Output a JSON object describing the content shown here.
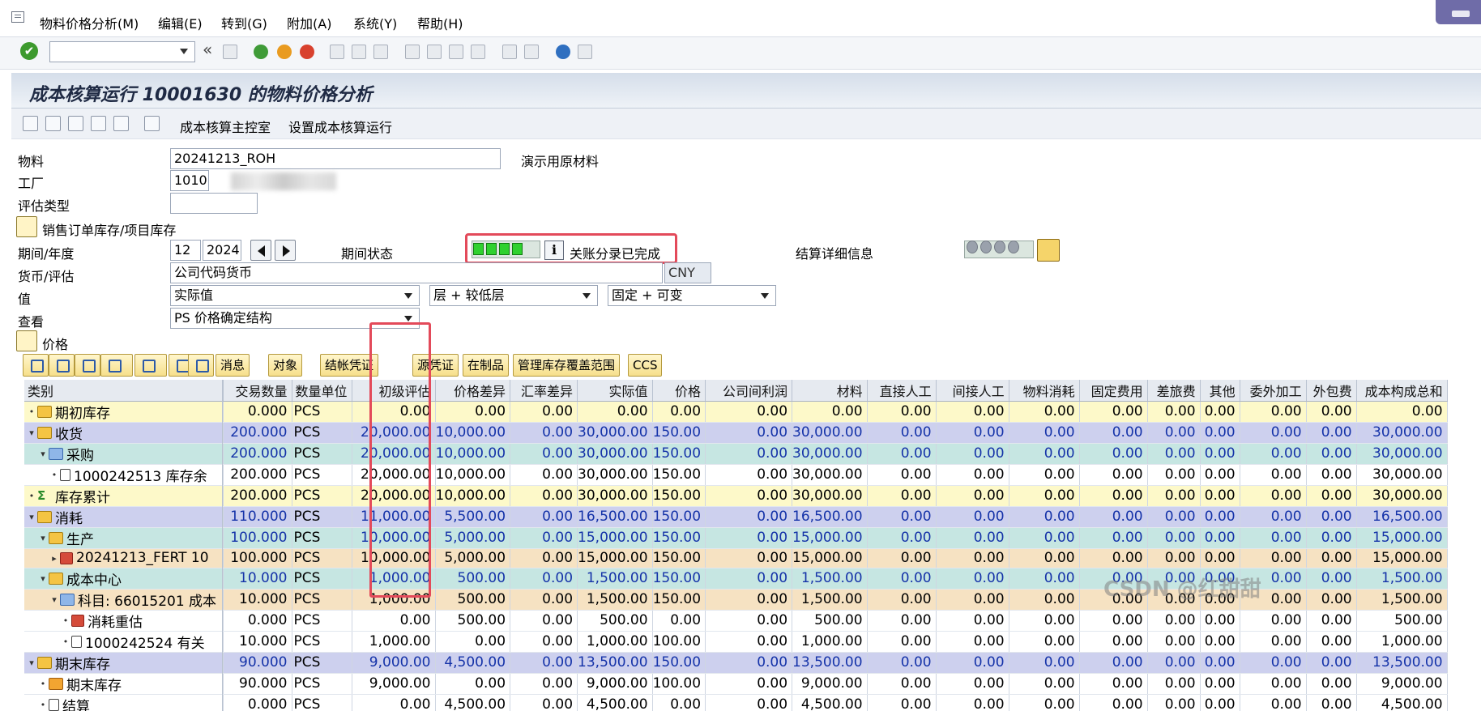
{
  "menubar": {
    "items": [
      "物料价格分析(M)",
      "编辑(E)",
      "转到(G)",
      "附加(A)",
      "系统(Y)",
      "帮助(H)"
    ]
  },
  "toolbar": {
    "command_value": ""
  },
  "header": {
    "title": "成本核算运行 10001630 的物料价格分析"
  },
  "app_toolbar": {
    "btn_cockpit": "成本核算主控室",
    "btn_setup": "设置成本核算运行"
  },
  "form": {
    "material_label": "物料",
    "material_value": "20241213_ROH",
    "material_desc": "演示用原材料",
    "plant_label": "工厂",
    "plant_value": "1010",
    "valtype_label": "评估类型",
    "valtype_value": "",
    "sales_order_label": "销售订单库存/项目库存",
    "period_label": "期间/年度",
    "period_value": "12",
    "year_value": "2024",
    "period_status_label": "期间状态",
    "period_status_text": "关账分录已完成",
    "settlement_label": "结算详细信息",
    "currency_label": "货币/评估",
    "currency_value": "公司代码货币",
    "currency_code": "CNY",
    "value_label": "值",
    "value_select": "实际值",
    "level_select": "层 + 较低层",
    "fixvar_select": "固定 + 可变",
    "view_label": "查看",
    "view_select": "PS 价格确定结构",
    "price_section": "价格"
  },
  "grid_toolbar": {
    "messages": "消息",
    "objects": "对象",
    "settle_doc": "结帐凭证",
    "source_doc": "源凭证",
    "wip": "在制品",
    "stock_range": "管理库存覆盖范围",
    "ccs": "CCS"
  },
  "table": {
    "headers": [
      "类别",
      "交易数量",
      "数量单位",
      "初级评估",
      "价格差异",
      "汇率差异",
      "实际值",
      "价格",
      "公司间利润",
      "材料",
      "直接人工",
      "间接人工",
      "物料消耗",
      "固定费用",
      "差旅费",
      "其他",
      "委外加工",
      "外包费",
      "成本构成总和"
    ],
    "rows": [
      {
        "tree": "•",
        "icon": "folder",
        "label": "期初库存",
        "indent": 0,
        "style": "yellow",
        "blue": false,
        "v": [
          "0.000",
          "PCS",
          "0.00",
          "0.00",
          "0.00",
          "0.00",
          "0.00",
          "0.00",
          "0.00",
          "0.00",
          "0.00",
          "0.00",
          "0.00",
          "0.00",
          "0.00",
          "0.00",
          "0.00",
          "0.00"
        ]
      },
      {
        "tree": "▾",
        "icon": "folder",
        "label": "收货",
        "indent": 0,
        "style": "lav",
        "blue": true,
        "v": [
          "200.000",
          "PCS",
          "20,000.00",
          "10,000.00",
          "0.00",
          "30,000.00",
          "150.00",
          "0.00",
          "30,000.00",
          "0.00",
          "0.00",
          "0.00",
          "0.00",
          "0.00",
          "0.00",
          "0.00",
          "0.00",
          "30,000.00"
        ]
      },
      {
        "tree": "▾",
        "icon": "blue",
        "label": "采购",
        "indent": 1,
        "style": "teal",
        "blue": true,
        "v": [
          "200.000",
          "PCS",
          "20,000.00",
          "10,000.00",
          "0.00",
          "30,000.00",
          "150.00",
          "0.00",
          "30,000.00",
          "0.00",
          "0.00",
          "0.00",
          "0.00",
          "0.00",
          "0.00",
          "0.00",
          "0.00",
          "30,000.00"
        ]
      },
      {
        "tree": "•",
        "icon": "doc",
        "label": "1000242513 库存余",
        "indent": 2,
        "style": "white",
        "blue": false,
        "v": [
          "200.000",
          "PCS",
          "20,000.00",
          "10,000.00",
          "0.00",
          "30,000.00",
          "150.00",
          "0.00",
          "30,000.00",
          "0.00",
          "0.00",
          "0.00",
          "0.00",
          "0.00",
          "0.00",
          "0.00",
          "0.00",
          "30,000.00"
        ]
      },
      {
        "tree": "•",
        "icon": "sig",
        "label": "库存累计",
        "indent": 0,
        "style": "yellow",
        "blue": false,
        "v": [
          "200.000",
          "PCS",
          "20,000.00",
          "10,000.00",
          "0.00",
          "30,000.00",
          "150.00",
          "0.00",
          "30,000.00",
          "0.00",
          "0.00",
          "0.00",
          "0.00",
          "0.00",
          "0.00",
          "0.00",
          "0.00",
          "30,000.00"
        ]
      },
      {
        "tree": "▾",
        "icon": "folder",
        "label": "消耗",
        "indent": 0,
        "style": "lav",
        "blue": true,
        "v": [
          "110.000",
          "PCS",
          "11,000.00",
          "5,500.00",
          "0.00",
          "16,500.00",
          "150.00",
          "0.00",
          "16,500.00",
          "0.00",
          "0.00",
          "0.00",
          "0.00",
          "0.00",
          "0.00",
          "0.00",
          "0.00",
          "16,500.00"
        ]
      },
      {
        "tree": "▾",
        "icon": "folder",
        "label": "生产",
        "indent": 1,
        "style": "teal",
        "blue": true,
        "v": [
          "100.000",
          "PCS",
          "10,000.00",
          "5,000.00",
          "0.00",
          "15,000.00",
          "150.00",
          "0.00",
          "15,000.00",
          "0.00",
          "0.00",
          "0.00",
          "0.00",
          "0.00",
          "0.00",
          "0.00",
          "0.00",
          "15,000.00"
        ]
      },
      {
        "tree": "▸",
        "icon": "red",
        "label": "20241213_FERT 10",
        "indent": 2,
        "style": "peach",
        "blue": false,
        "v": [
          "100.000",
          "PCS",
          "10,000.00",
          "5,000.00",
          "0.00",
          "15,000.00",
          "150.00",
          "0.00",
          "15,000.00",
          "0.00",
          "0.00",
          "0.00",
          "0.00",
          "0.00",
          "0.00",
          "0.00",
          "0.00",
          "15,000.00"
        ]
      },
      {
        "tree": "▾",
        "icon": "folder",
        "label": "成本中心",
        "indent": 1,
        "style": "teal",
        "blue": true,
        "v": [
          "10.000",
          "PCS",
          "1,000.00",
          "500.00",
          "0.00",
          "1,500.00",
          "150.00",
          "0.00",
          "1,500.00",
          "0.00",
          "0.00",
          "0.00",
          "0.00",
          "0.00",
          "0.00",
          "0.00",
          "0.00",
          "1,500.00"
        ]
      },
      {
        "tree": "▾",
        "icon": "blue",
        "label": "科目: 66015201 成本",
        "indent": 2,
        "style": "peach",
        "blue": false,
        "v": [
          "10.000",
          "PCS",
          "1,000.00",
          "500.00",
          "0.00",
          "1,500.00",
          "150.00",
          "0.00",
          "1,500.00",
          "0.00",
          "0.00",
          "0.00",
          "0.00",
          "0.00",
          "0.00",
          "0.00",
          "0.00",
          "1,500.00"
        ]
      },
      {
        "tree": "•",
        "icon": "red",
        "label": "消耗重估",
        "indent": 3,
        "style": "white",
        "blue": false,
        "v": [
          "0.000",
          "PCS",
          "0.00",
          "500.00",
          "0.00",
          "500.00",
          "0.00",
          "0.00",
          "500.00",
          "0.00",
          "0.00",
          "0.00",
          "0.00",
          "0.00",
          "0.00",
          "0.00",
          "0.00",
          "500.00"
        ]
      },
      {
        "tree": "•",
        "icon": "doc",
        "label": "1000242524 有关",
        "indent": 3,
        "style": "white",
        "blue": false,
        "v": [
          "10.000",
          "PCS",
          "1,000.00",
          "0.00",
          "0.00",
          "1,000.00",
          "100.00",
          "0.00",
          "1,000.00",
          "0.00",
          "0.00",
          "0.00",
          "0.00",
          "0.00",
          "0.00",
          "0.00",
          "0.00",
          "1,000.00"
        ]
      },
      {
        "tree": "▾",
        "icon": "folder",
        "label": "期末库存",
        "indent": 0,
        "style": "lav",
        "blue": true,
        "v": [
          "90.000",
          "PCS",
          "9,000.00",
          "4,500.00",
          "0.00",
          "13,500.00",
          "150.00",
          "0.00",
          "13,500.00",
          "0.00",
          "0.00",
          "0.00",
          "0.00",
          "0.00",
          "0.00",
          "0.00",
          "0.00",
          "13,500.00"
        ]
      },
      {
        "tree": "•",
        "icon": "hier",
        "label": "期末库存",
        "indent": 1,
        "style": "white",
        "blue": false,
        "v": [
          "90.000",
          "PCS",
          "9,000.00",
          "0.00",
          "0.00",
          "9,000.00",
          "100.00",
          "0.00",
          "9,000.00",
          "0.00",
          "0.00",
          "0.00",
          "0.00",
          "0.00",
          "0.00",
          "0.00",
          "0.00",
          "9,000.00"
        ]
      },
      {
        "tree": "•",
        "icon": "doc",
        "label": "结算",
        "indent": 1,
        "style": "white",
        "blue": false,
        "v": [
          "0.000",
          "PCS",
          "0.00",
          "4,500.00",
          "0.00",
          "4,500.00",
          "0.00",
          "0.00",
          "4,500.00",
          "0.00",
          "0.00",
          "0.00",
          "0.00",
          "0.00",
          "0.00",
          "0.00",
          "0.00",
          "4,500.00"
        ]
      }
    ]
  },
  "watermark": "CSDN @红甜甜"
}
